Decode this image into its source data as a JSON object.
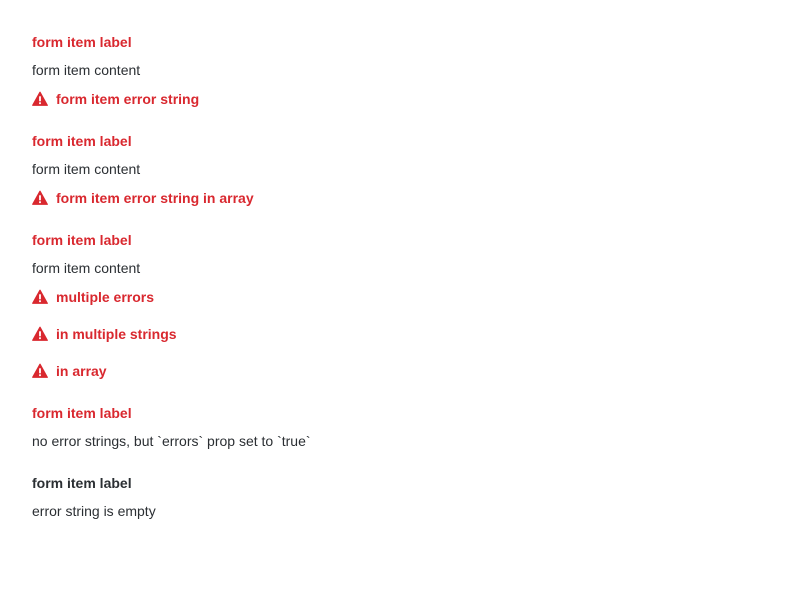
{
  "colors": {
    "error": "#d9282f",
    "text": "#2b2f33",
    "background": "#ffffff"
  },
  "icons": {
    "error": "warning-triangle-icon"
  },
  "form_items": [
    {
      "label": "form item label",
      "content": "form item content",
      "has_error": true,
      "errors": [
        "form item error string"
      ]
    },
    {
      "label": "form item label",
      "content": "form item content",
      "has_error": true,
      "errors": [
        "form item error string in array"
      ]
    },
    {
      "label": "form item label",
      "content": "form item content",
      "has_error": true,
      "errors": [
        "multiple errors",
        "in multiple strings",
        "in array"
      ]
    },
    {
      "label": "form item label",
      "content": "no error strings, but `errors` prop set to `true`",
      "has_error": true,
      "errors": []
    },
    {
      "label": "form item label",
      "content": "error string is empty",
      "has_error": false,
      "errors": []
    }
  ]
}
